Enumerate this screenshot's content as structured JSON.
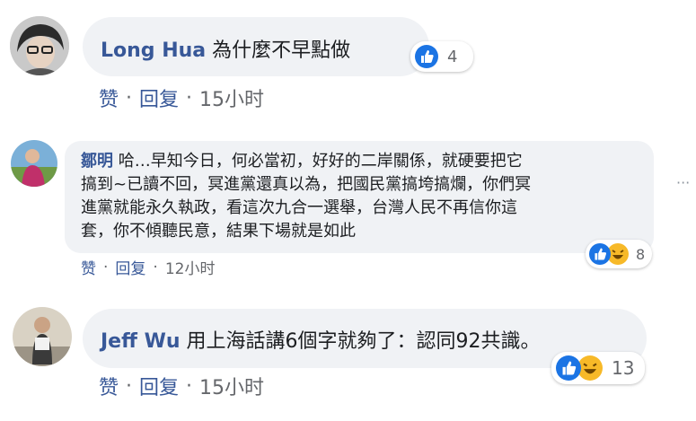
{
  "comments": [
    {
      "author": "Long Hua",
      "text": "為什麼不早點做",
      "reactions": {
        "icons": [
          "like-icon"
        ],
        "count": "4"
      },
      "actions": {
        "like": "赞",
        "reply": "回复",
        "time": "15小时"
      }
    },
    {
      "author": "鄒明",
      "text_lines": [
        "哈…早知今日，何必當初，好好的二岸關係，就硬要把它",
        "搞到~已讀不回，冥進黨還真以為，把國民黨搞垮搞爛，你們冥",
        "進黨就能永久執政，看這次九合一選舉，台灣人民不再信你這",
        "套，你不傾聽民意，結果下場就是如此"
      ],
      "reactions": {
        "icons": [
          "like-icon",
          "haha-icon"
        ],
        "count": "8"
      },
      "actions": {
        "like": "赞",
        "reply": "回复",
        "time": "12小时"
      },
      "more_icon": "more-dots-icon"
    },
    {
      "author": "Jeff Wu",
      "text": "用上海話講6個字就夠了：認同92共識。",
      "reactions": {
        "icons": [
          "like-icon",
          "haha-icon"
        ],
        "count": "13"
      },
      "actions": {
        "like": "赞",
        "reply": "回复",
        "time": "15小时"
      }
    }
  ],
  "separator": "·",
  "colors": {
    "link": "#385898",
    "bubble": "#f0f2f5",
    "like": "#1b74e4",
    "haha": "#f7b928",
    "meta": "#65676b"
  }
}
